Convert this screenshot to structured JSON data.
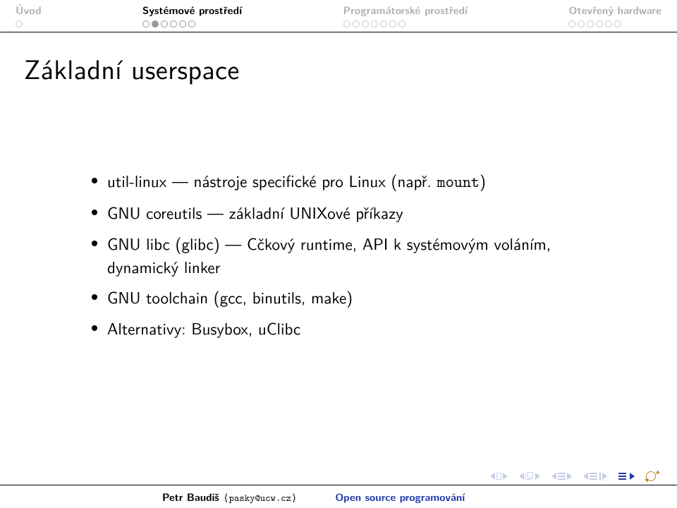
{
  "nav": {
    "sec1": {
      "label": "Úvod"
    },
    "sec2": {
      "label": "Systémové prostředí"
    },
    "sec3": {
      "label": "Programátorské prostředí"
    },
    "sec4": {
      "label": "Otevřený hardware"
    }
  },
  "title": "Základní userspace",
  "items": {
    "i0": "util-linux — nástroje specifické pro Linux (např. ",
    "i0mono": "mount",
    "i0tail": ")",
    "i1": "GNU coreutils — základní UNIXové příkazy",
    "i2": "GNU libc (glibc) — Cčkový runtime, API k systémovým voláním, dynamický linker",
    "i3": "GNU toolchain (gcc, binutils, make)",
    "i4": "Alternativy: Busybox, uClibc"
  },
  "footer": {
    "author": "Petr Baudiš ",
    "email": "⟨pasky@ucw.cz⟩",
    "title": "Open source programování"
  }
}
